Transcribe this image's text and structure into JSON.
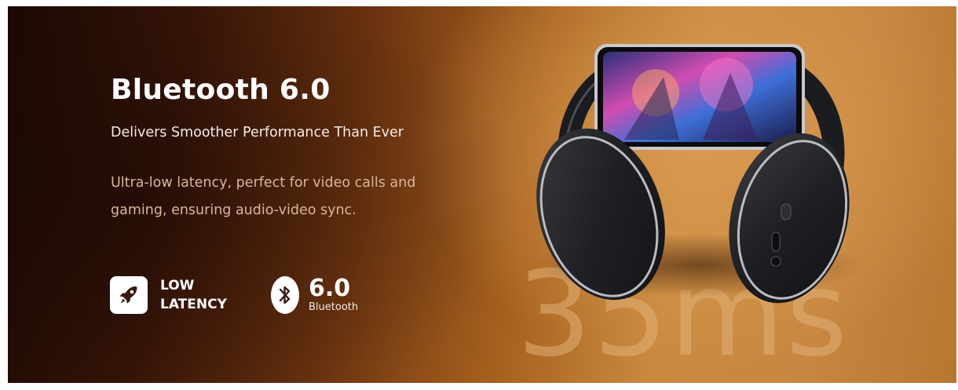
{
  "hero": {
    "title": "Bluetooth 6.0",
    "subtitle": "Delivers Smoother Performance Than Ever",
    "description": "Ultra-low latency, perfect for video calls and gaming, ensuring audio-video sync."
  },
  "features": {
    "latency": {
      "icon": "rocket-icon",
      "label": "LOW LATENCY"
    },
    "bluetooth": {
      "icon": "bluetooth-icon",
      "version": "6.0",
      "caption": "Bluetooth"
    }
  },
  "highlight": {
    "value": "35ms"
  },
  "colors": {
    "background_dark": "#1c0903",
    "background_warm": "#c98a3f",
    "text_primary": "#ffffff",
    "text_muted": "#d9b79a",
    "big_number": "#e0b076"
  }
}
